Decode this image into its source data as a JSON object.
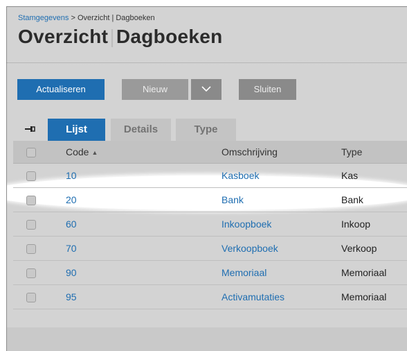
{
  "breadcrumb": {
    "parent": "Stamgegevens",
    "sep": " > ",
    "current": "Overzicht | Dagboeken"
  },
  "title": {
    "main": "Overzicht",
    "separator": "|",
    "sub": "Dagboeken"
  },
  "toolbar": {
    "refresh": "Actualiseren",
    "new": "Nieuw",
    "close": "Sluiten"
  },
  "tabs": [
    "Lijst",
    "Details",
    "Type"
  ],
  "columns": {
    "code": "Code",
    "description": "Omschrijving",
    "type": "Type"
  },
  "rows": [
    {
      "code": "10",
      "description": "Kasboek",
      "type": "Kas"
    },
    {
      "code": "20",
      "description": "Bank",
      "type": "Bank"
    },
    {
      "code": "60",
      "description": "Inkoopboek",
      "type": "Inkoop"
    },
    {
      "code": "70",
      "description": "Verkoopboek",
      "type": "Verkoop"
    },
    {
      "code": "90",
      "description": "Memoriaal",
      "type": "Memoriaal"
    },
    {
      "code": "95",
      "description": "Activamutaties",
      "type": "Memoriaal"
    }
  ],
  "colors": {
    "accent": "#1f6eb1",
    "background": "#d3d3d3",
    "disabled": "#9a9a9a"
  },
  "icons": {
    "pin": "pin-icon",
    "dropdown": "chevron-down-icon",
    "sort": "sort-ascending-icon"
  }
}
